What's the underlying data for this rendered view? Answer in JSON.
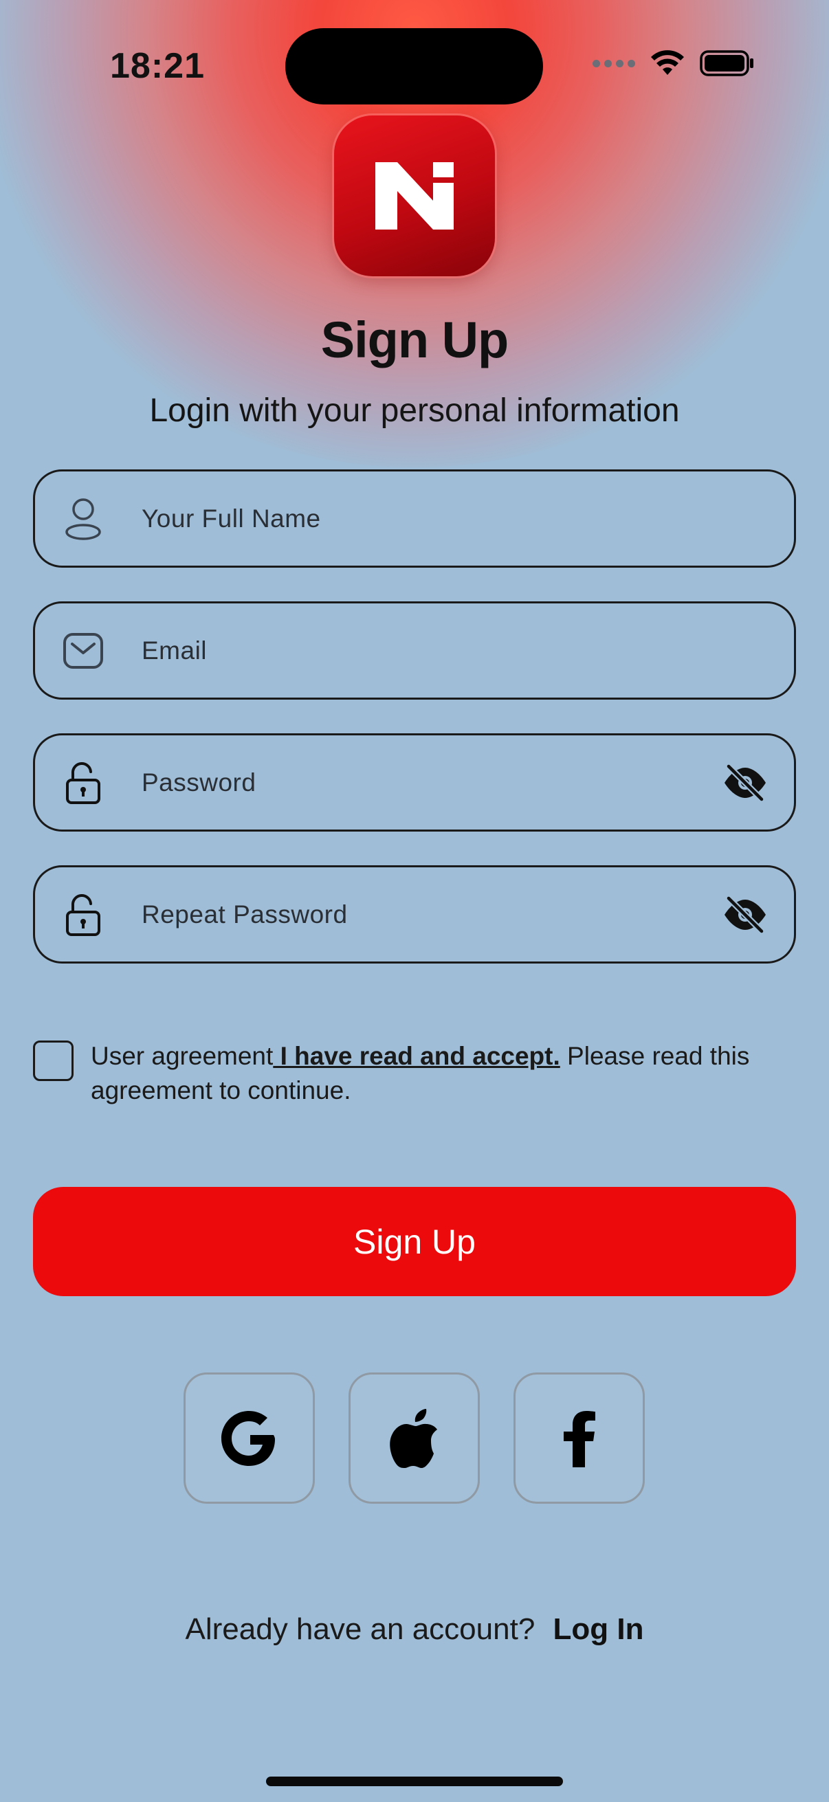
{
  "status_bar": {
    "time": "18:21",
    "icons": [
      "signal-icon",
      "wifi-icon",
      "battery-icon"
    ]
  },
  "header": {
    "logo_icon": "app-logo",
    "title": "Sign Up",
    "subtitle": "Login with your personal information"
  },
  "form": {
    "full_name": {
      "placeholder": "Your Full Name",
      "icon": "user-icon"
    },
    "email": {
      "placeholder": "Email",
      "icon": "mail-icon"
    },
    "password": {
      "placeholder": "Password",
      "icon": "unlock-icon",
      "toggle_icon": "eye-off-icon"
    },
    "repeat_password": {
      "placeholder": "Repeat Password",
      "icon": "unlock-icon",
      "toggle_icon": "eye-off-icon"
    }
  },
  "agreement": {
    "prefix": "User agreement",
    "link": " I have read and accept.",
    "suffix": " Please read this agreement to continue.",
    "checked": false
  },
  "signup_button": {
    "label": "Sign Up",
    "color": "#ec0a0c"
  },
  "social": [
    {
      "name": "google",
      "icon": "google-icon"
    },
    {
      "name": "apple",
      "icon": "apple-icon"
    },
    {
      "name": "facebook",
      "icon": "facebook-icon"
    }
  ],
  "footer": {
    "question": "Already have an account?",
    "login_link": "Log In"
  },
  "colors": {
    "background": "#9fbdd6",
    "accent": "#ec0a0c",
    "glow": "#f3463c"
  }
}
